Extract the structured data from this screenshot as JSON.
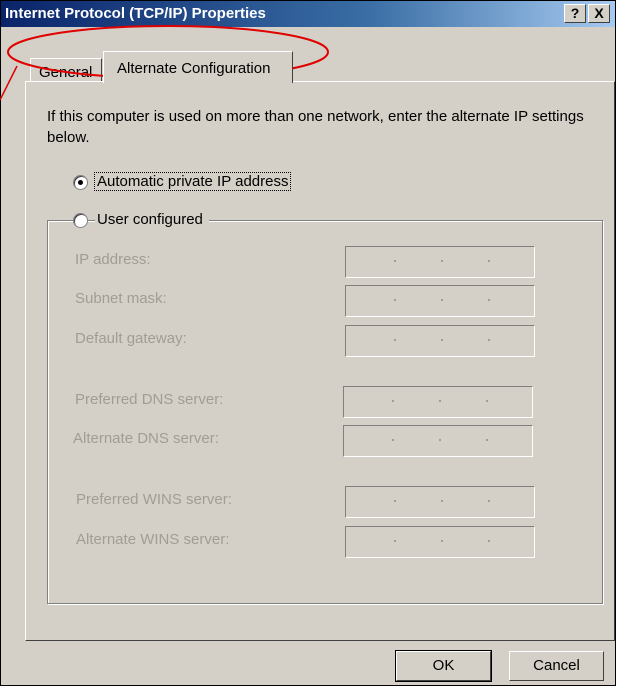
{
  "window": {
    "title": "Internet Protocol (TCP/IP) Properties",
    "help_label": "?",
    "close_label": "X"
  },
  "tabs": [
    {
      "label": "General",
      "selected": false
    },
    {
      "label": "Alternate Configuration",
      "selected": true
    }
  ],
  "intro_text": "If this computer is used on more than one network, enter the alternate IP settings below.",
  "options": {
    "automatic_label": "Automatic private IP address",
    "automatic_selected": true,
    "user_label": "User configured",
    "user_selected": false
  },
  "fields": [
    {
      "label": "IP address:",
      "value": ". . ."
    },
    {
      "label": "Subnet mask:",
      "value": ". . ."
    },
    {
      "label": "Default gateway:",
      "value": ". . ."
    },
    {
      "label": "Preferred DNS server:",
      "value": ". . ."
    },
    {
      "label": "Alternate DNS server:",
      "value": ". . ."
    },
    {
      "label": "Preferred WINS server:",
      "value": ". . ."
    },
    {
      "label": "Alternate WINS server:",
      "value": ". . ."
    }
  ],
  "buttons": {
    "ok_label": "OK",
    "cancel_label": "Cancel"
  },
  "colors": {
    "annotation": "#e00000",
    "title_bar": "#0a246a",
    "disabled_text": "#a19d95"
  }
}
